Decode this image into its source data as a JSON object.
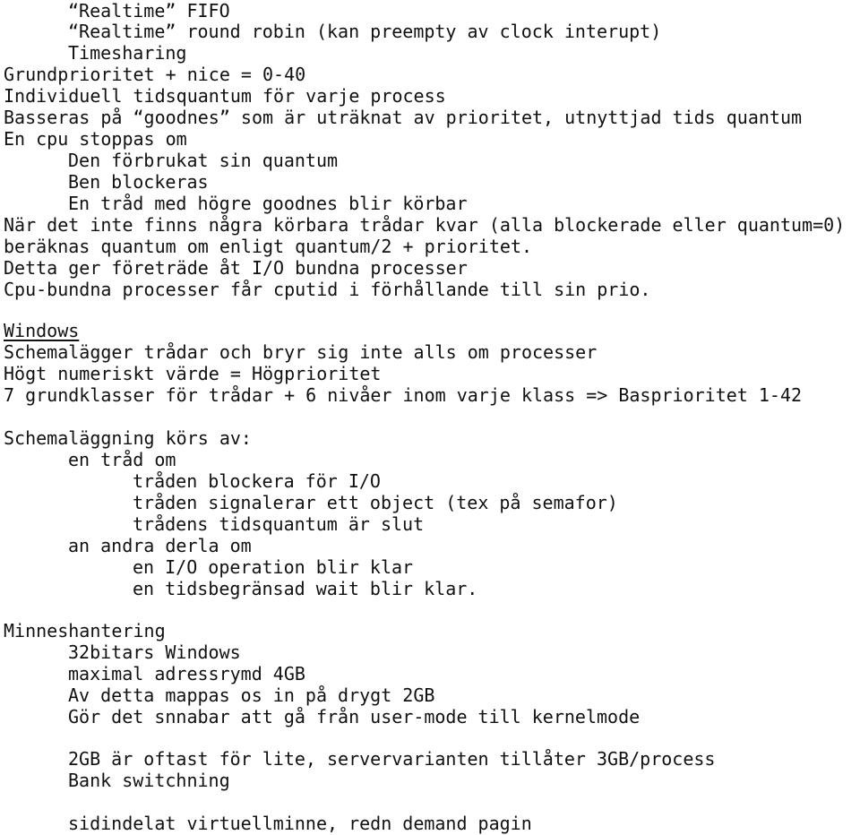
{
  "linux_scheduling": {
    "classes": [
      "“Realtime” FIFO",
      "“Realtime” round robin (kan preempty av clock interupt)",
      "Timesharing"
    ],
    "lines": [
      "Grundprioritet + nice = 0-40",
      "Individuell tidsquantum för varje process",
      "Basseras på “goodnes” som är uträknat av prioritet, utnyttjad tids quantum",
      "En cpu stoppas om"
    ],
    "stop_reasons": [
      "Den förbrukat sin quantum",
      "Ben blockeras",
      "En tråd med högre goodnes blir körbar"
    ],
    "recalc": [
      "När det inte finns några körbara trådar kvar (alla blockerade eller quantum=0)",
      "beräknas quantum om enligt quantum/2 + prioritet.",
      "Detta ger företräde åt I/O bundna processer",
      "Cpu-bundna processer får cputid i förhållande till sin prio."
    ]
  },
  "windows": {
    "heading": "Windows",
    "lines": [
      "Schemalägger trådar och bryr sig inte alls om processer",
      "Högt numeriskt värde = Högprioritet",
      "7 grundklasser för trådar + 6 nivåer inom varje klass => Basprioritet 1-42"
    ],
    "scheduling": {
      "heading": "Schemaläggning körs av:",
      "own_thread": {
        "label": "en tråd om",
        "items": [
          "tråden blockera för I/O",
          "tråden signalerar ett object (tex på semafor)",
          "trådens tidsquantum är slut"
        ]
      },
      "other_thread": {
        "label": "an andra derla om",
        "items": [
          "en I/O operation blir klar",
          "en tidsbegränsad wait blir klar."
        ]
      }
    }
  },
  "memory": {
    "heading": "Minneshantering",
    "lines": [
      "32bitars Windows",
      "maximal adressrymd 4GB",
      "Av detta mappas os in på drygt 2GB",
      "Gör det snnabar att gå från user-mode till kernelmode"
    ],
    "lines2": [
      "2GB är oftast för lite, servervarianten tillåter 3GB/process",
      "Bank switchning"
    ],
    "lines3": [
      "sidindelat virtuellminne, redn demand pagin"
    ]
  }
}
